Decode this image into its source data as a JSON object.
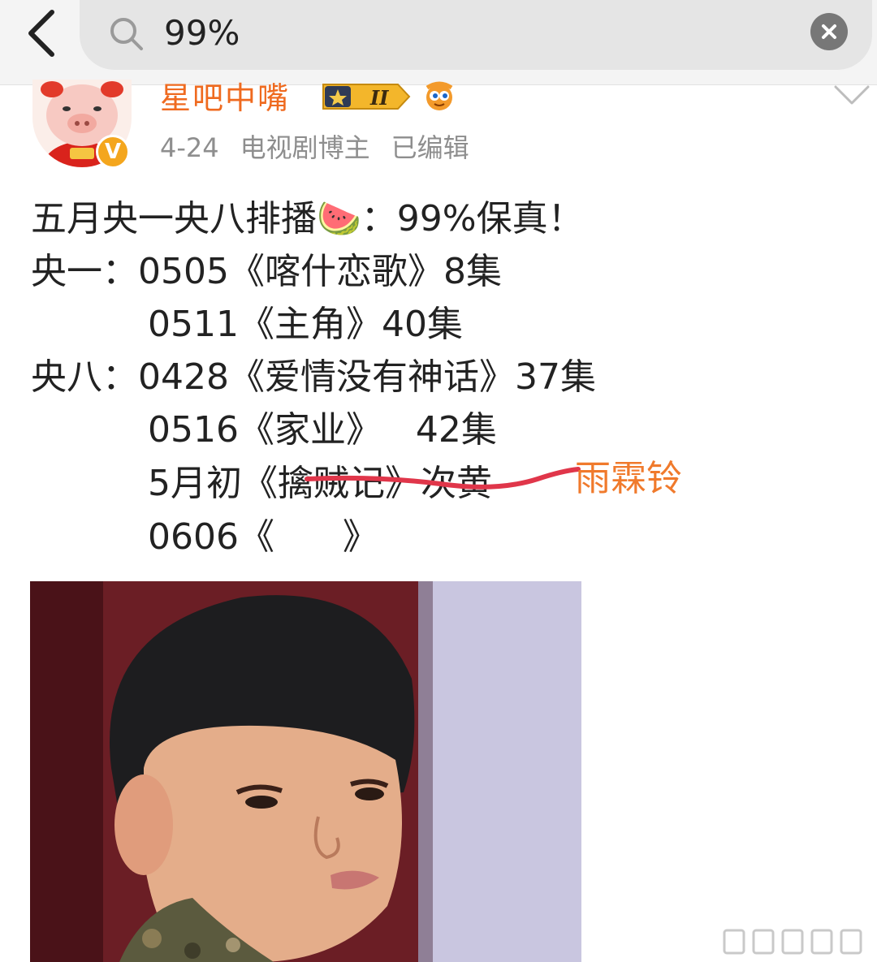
{
  "search": {
    "query": "99%"
  },
  "post": {
    "username": "星吧中嘴",
    "level_badge": "II",
    "verified_mark": "V",
    "date": "4-24",
    "role": "电视剧博主",
    "edited": "已编辑",
    "lines": [
      "五月央一央八排播🍉：99%保真！",
      "央一：0505《喀什恋歌》8集",
      "0511《主角》40集",
      "央八：0428《爱情没有神话》37集",
      "0516《家业》   42集",
      "5月初《擒贼记》次黄",
      "0606《      》"
    ],
    "annotation": "雨霖铃"
  },
  "icons": {
    "back": "back-arrow-icon",
    "search": "search-icon",
    "clear": "clear-icon",
    "more": "chevron-down-icon"
  },
  "colors": {
    "username": "#ef6a1f",
    "annotation": "#f07a2c",
    "annotation_stroke": "#e0364a"
  }
}
